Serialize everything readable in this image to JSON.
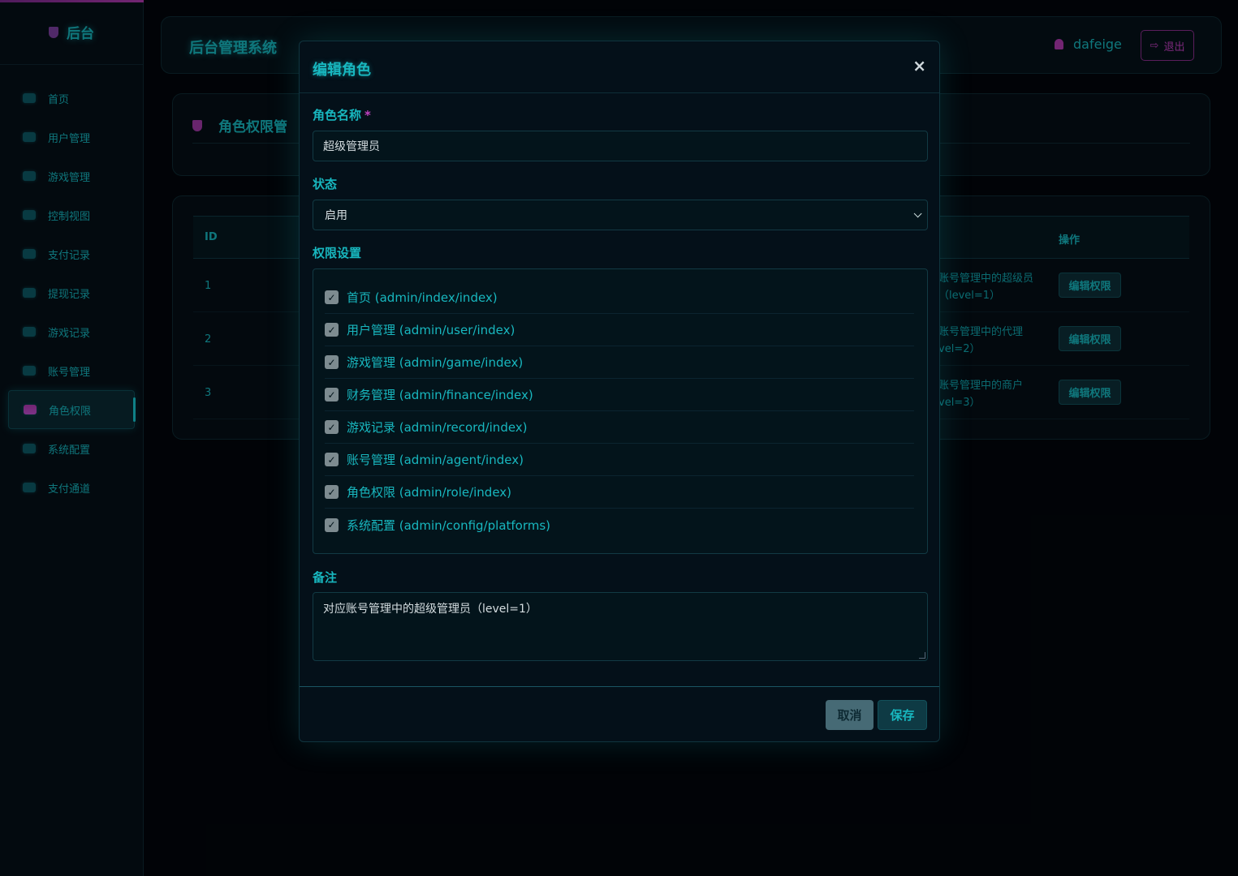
{
  "sidebar": {
    "brand": "后台",
    "items": [
      {
        "label": "首页",
        "icon": "dashboard-icon"
      },
      {
        "label": "用户管理",
        "icon": "users-icon"
      },
      {
        "label": "游戏管理",
        "icon": "gamepad-icon"
      },
      {
        "label": "控制视图",
        "icon": "sliders-icon"
      },
      {
        "label": "支付记录",
        "icon": "money-icon"
      },
      {
        "label": "提现记录",
        "icon": "money-icon"
      },
      {
        "label": "游戏记录",
        "icon": "list-icon"
      },
      {
        "label": "账号管理",
        "icon": "user-icon"
      },
      {
        "label": "角色权限",
        "icon": "id-card-icon",
        "active": true
      },
      {
        "label": "系统配置",
        "icon": "gear-icon"
      },
      {
        "label": "支付通道",
        "icon": "channel-icon"
      }
    ]
  },
  "header": {
    "title": "后台管理系统",
    "username": "dafeige",
    "logout": "退出"
  },
  "page": {
    "title": "角色权限管"
  },
  "table": {
    "col_id": "ID",
    "col_action": "操作",
    "rows": [
      {
        "id": "1",
        "note": "账号管理中的超级员（level=1）",
        "action": "编辑权限"
      },
      {
        "id": "2",
        "note": "账号管理中的代理vel=2）",
        "action": "编辑权限"
      },
      {
        "id": "3",
        "note": "账号管理中的商户vel=3）",
        "action": "编辑权限"
      }
    ]
  },
  "modal": {
    "title": "编辑角色",
    "close": "×",
    "name_label": "角色名称",
    "required_mark": "*",
    "name_value": "超级管理员",
    "status_label": "状态",
    "status_value": "启用",
    "perm_label": "权限设置",
    "permissions": [
      {
        "label": "首页 (admin/index/index)",
        "checked": true
      },
      {
        "label": "用户管理 (admin/user/index)",
        "checked": true
      },
      {
        "label": "游戏管理 (admin/game/index)",
        "checked": true
      },
      {
        "label": "财务管理 (admin/finance/index)",
        "checked": true
      },
      {
        "label": "游戏记录 (admin/record/index)",
        "checked": true
      },
      {
        "label": "账号管理 (admin/agent/index)",
        "checked": true
      },
      {
        "label": "角色权限 (admin/role/index)",
        "checked": true
      },
      {
        "label": "系统配置 (admin/config/platforms)",
        "checked": true
      }
    ],
    "remark_label": "备注",
    "remark_value": "对应账号管理中的超级管理员（level=1）",
    "cancel": "取消",
    "save": "保存"
  }
}
